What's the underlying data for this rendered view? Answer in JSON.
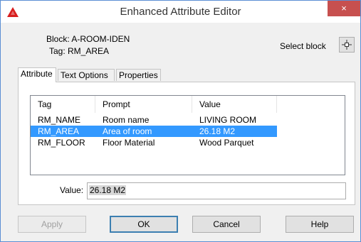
{
  "window": {
    "title": "Enhanced Attribute Editor",
    "close_glyph": "×"
  },
  "block_info": {
    "block_line": "Block: A-ROOM-IDEN",
    "tag_line": "Tag: RM_AREA"
  },
  "select_block": {
    "label": "Select block",
    "icon": "pick-crosshair-icon"
  },
  "tabs": [
    {
      "label": "Attribute",
      "active": true
    },
    {
      "label": "Text Options",
      "active": false
    },
    {
      "label": "Properties",
      "active": false
    }
  ],
  "table": {
    "columns": [
      "Tag",
      "Prompt",
      "Value"
    ],
    "rows": [
      {
        "tag": "RM_NAME",
        "prompt": "Room name",
        "value": "LIVING ROOM",
        "selected": false
      },
      {
        "tag": "RM_AREA",
        "prompt": "Area of room",
        "value": "26.18 M2",
        "selected": true
      },
      {
        "tag": "RM_FLOOR",
        "prompt": "Floor Material",
        "value": "Wood Parquet",
        "selected": false
      }
    ]
  },
  "value_field": {
    "label": "Value:",
    "value": "26.18 M2"
  },
  "buttons": {
    "apply": "Apply",
    "ok": "OK",
    "cancel": "Cancel",
    "help": "Help"
  },
  "colors": {
    "selection": "#3399ff",
    "close_button": "#c7504f",
    "app_icon": "#d81e1e"
  }
}
